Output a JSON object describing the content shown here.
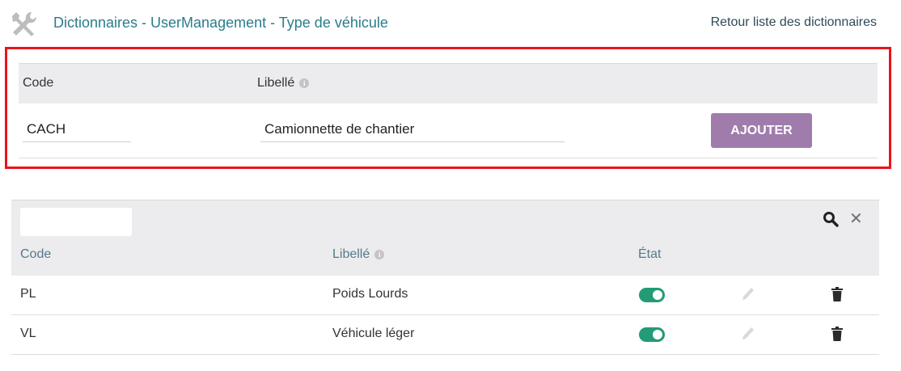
{
  "header": {
    "icon": "tools-icon",
    "title": "Dictionnaires - UserManagement - Type de véhicule",
    "back_link": "Retour liste des dictionnaires"
  },
  "add_form": {
    "columns": {
      "code": "Code",
      "libelle": "Libellé"
    },
    "code_value": "CACH",
    "libelle_value": "Camionnette de chantier",
    "submit_label": "AJOUTER",
    "button_color": "#a07cad",
    "highlight_color": "#e8141c"
  },
  "list": {
    "filter_value": "",
    "columns": {
      "code": "Code",
      "libelle": "Libellé",
      "etat": "État"
    },
    "rows": [
      {
        "code": "PL",
        "libelle": "Poids Lourds",
        "etat_active": true
      },
      {
        "code": "VL",
        "libelle": "Véhicule léger",
        "etat_active": true
      }
    ],
    "toggle_color": "#229b76"
  }
}
